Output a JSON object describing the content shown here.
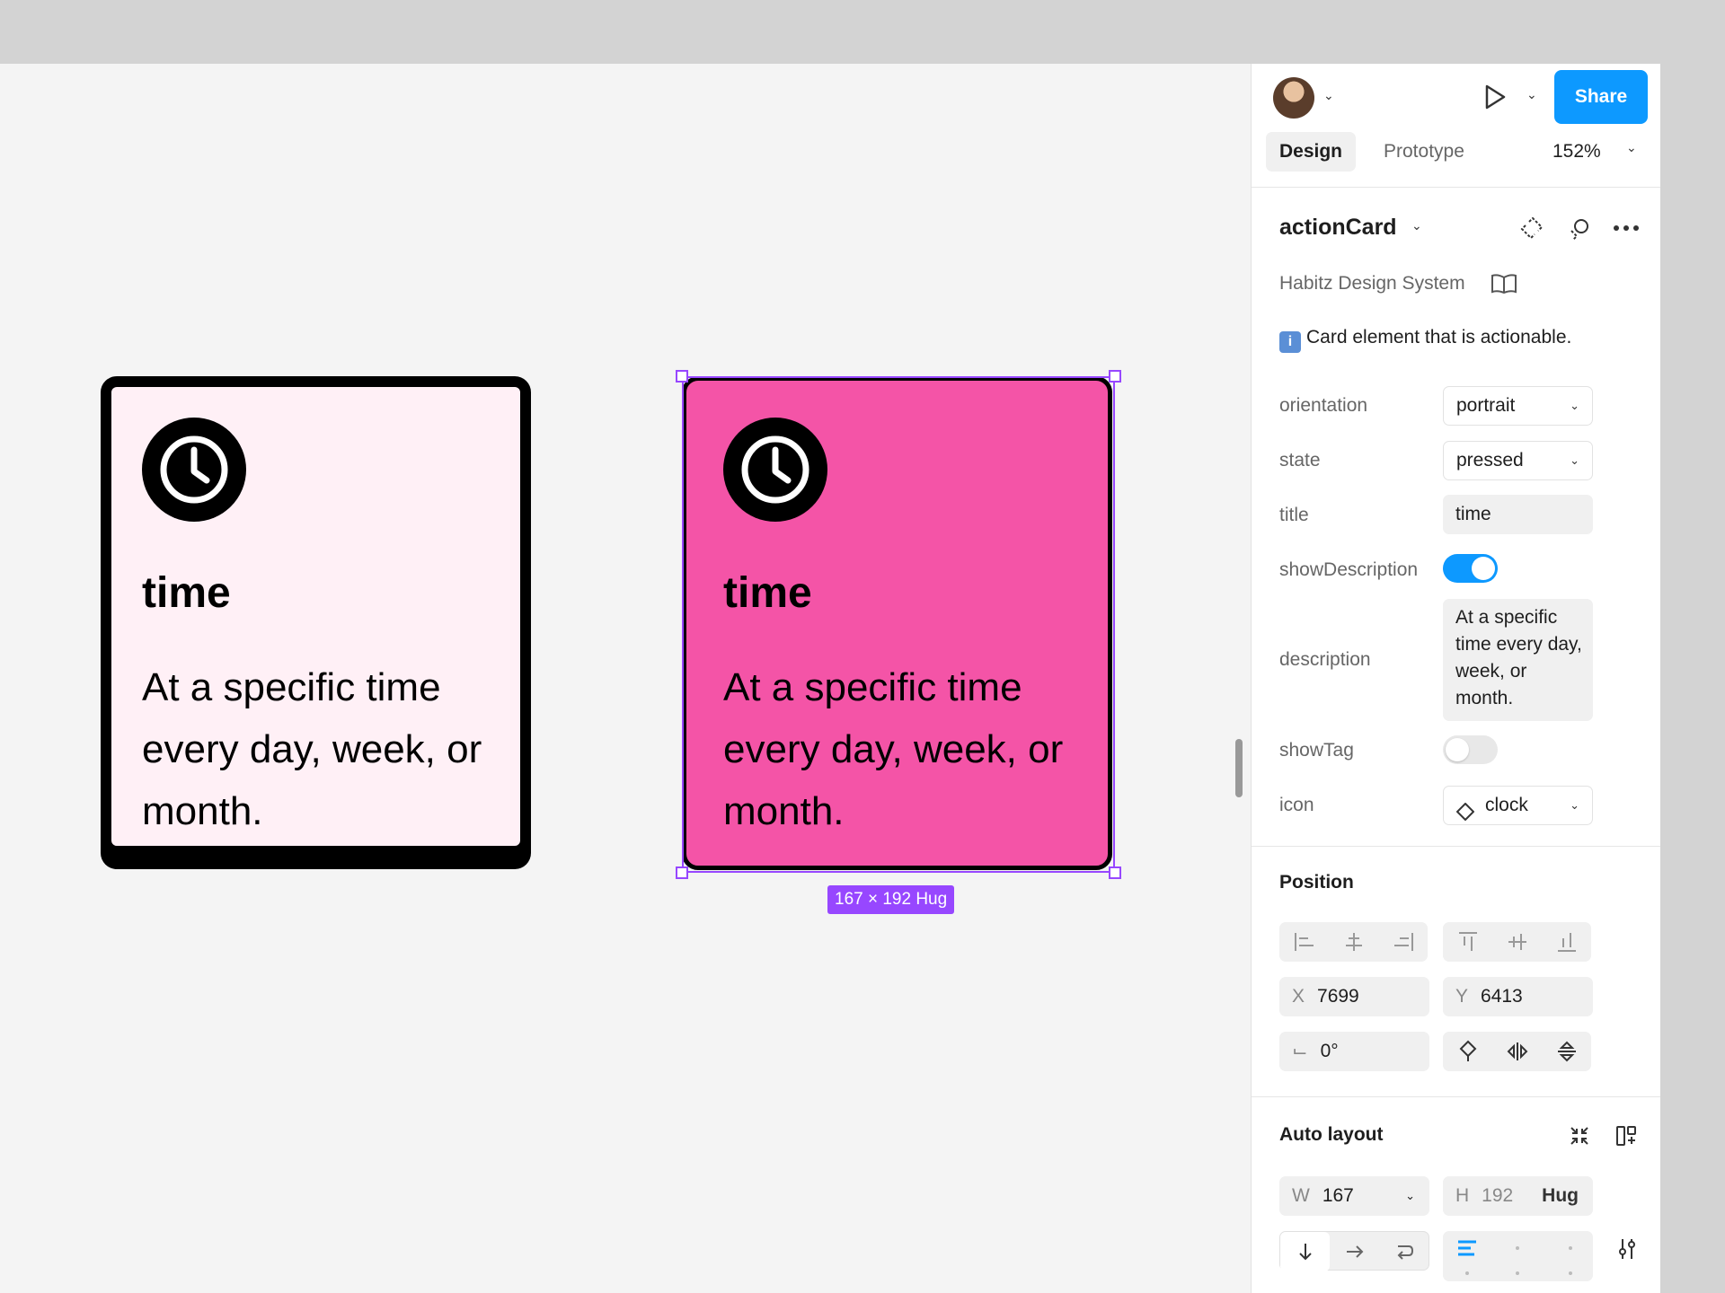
{
  "cards": [
    {
      "variant": "default",
      "title": "time",
      "description": "At a specific time every day, week, or month."
    },
    {
      "variant": "pressed",
      "title": "time",
      "description": "At a specific time every day, week, or month."
    }
  ],
  "selection_badge": "167 × 192 Hug",
  "header": {
    "share_label": "Share",
    "zoom": "152%"
  },
  "tabs": [
    {
      "label": "Design",
      "active": true
    },
    {
      "label": "Prototype",
      "active": false
    }
  ],
  "component": {
    "name": "actionCard",
    "library": "Habitz Design System",
    "info_icon": "i",
    "description_text": "Card element that is actionable."
  },
  "properties": {
    "orientation": {
      "label": "orientation",
      "value": "portrait"
    },
    "state": {
      "label": "state",
      "value": "pressed"
    },
    "title": {
      "label": "title",
      "value": "time"
    },
    "show_description": {
      "label": "showDescription",
      "on": true
    },
    "description": {
      "label": "description",
      "value": "At a specific time every day, week, or month."
    },
    "show_tag": {
      "label": "showTag",
      "on": false
    },
    "icon": {
      "label": "icon",
      "value": "clock"
    }
  },
  "position": {
    "title": "Position",
    "x_label": "X",
    "x_value": "7699",
    "y_label": "Y",
    "y_value": "6413",
    "rotation": "0°"
  },
  "auto_layout": {
    "title": "Auto layout",
    "w_label": "W",
    "w_value": "167",
    "h_label": "H",
    "h_value": "192",
    "h_mode": "Hug"
  },
  "colors": {
    "accent": "#0d99ff",
    "selection": "#9747ff",
    "card_pressed": "#f454a7",
    "card_default": "#fff0f6"
  },
  "icons": [
    "clock-icon",
    "play-icon",
    "chevron-down-icon",
    "detach-icon",
    "swap-icon",
    "more-icon",
    "book-icon",
    "diamond-icon"
  ]
}
